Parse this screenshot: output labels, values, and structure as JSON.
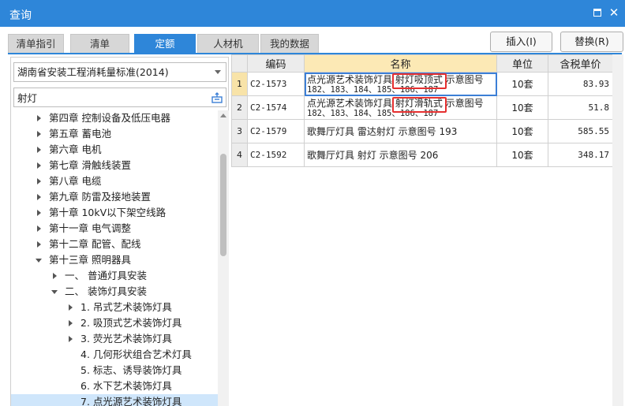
{
  "window": {
    "title": "查询"
  },
  "tabs": [
    {
      "label": "清单指引",
      "active": false
    },
    {
      "label": "清单",
      "active": false
    },
    {
      "label": "定额",
      "active": true
    },
    {
      "label": "人材机",
      "active": false
    },
    {
      "label": "我的数据",
      "active": false
    }
  ],
  "actions": {
    "insert_label": "插入(I)",
    "replace_label": "替换(R)"
  },
  "library": {
    "selected": "湖南省安装工程消耗量标准(2014)"
  },
  "search": {
    "value": "射灯"
  },
  "tree": [
    {
      "label": "第四章 控制设备及低压电器",
      "caret": "right"
    },
    {
      "label": "第五章 蓄电池",
      "caret": "right"
    },
    {
      "label": "第六章 电机",
      "caret": "right"
    },
    {
      "label": "第七章 滑触线装置",
      "caret": "right"
    },
    {
      "label": "第八章 电缆",
      "caret": "right"
    },
    {
      "label": "第九章 防雷及接地装置",
      "caret": "right"
    },
    {
      "label": "第十章 10kV以下架空线路",
      "caret": "right"
    },
    {
      "label": "第十一章 电气调整",
      "caret": "right"
    },
    {
      "label": "第十二章 配管、配线",
      "caret": "right"
    },
    {
      "label": "第十三章 照明器具",
      "caret": "down"
    },
    {
      "label": "一、 普通灯具安装",
      "caret": "right"
    },
    {
      "label": "二、 装饰灯具安装",
      "caret": "down"
    },
    {
      "label": "1. 吊式艺术装饰灯具",
      "caret": "right"
    },
    {
      "label": "2. 吸顶式艺术装饰灯具",
      "caret": "right"
    },
    {
      "label": "3. 荧光艺术装饰灯具",
      "caret": "right"
    },
    {
      "label": "4. 几何形状组合艺术灯具",
      "caret": "none"
    },
    {
      "label": "5. 标志、诱导装饰灯具",
      "caret": "none"
    },
    {
      "label": "6. 水下艺术装饰灯具",
      "caret": "none"
    },
    {
      "label": "7. 点光源艺术装饰灯具",
      "caret": "none",
      "selected": true
    }
  ],
  "grid": {
    "headers": {
      "code": "编码",
      "name": "名称",
      "unit": "单位",
      "price": "含税单价"
    },
    "rows": [
      {
        "num": "1",
        "code": "C2-1573",
        "name_pre": "点光源艺术装饰灯具 ",
        "name_hl": "射灯吸顶式",
        "name_post": " 示意图号",
        "name_sub": "182、183、184、185、186、187",
        "unit": "10套",
        "price": "83.93"
      },
      {
        "num": "2",
        "code": "C2-1574",
        "name_pre": "点光源艺术装饰灯具 ",
        "name_hl": "射灯滑轨式",
        "name_post": " 示意图号",
        "name_sub": "182、183、184、185、186、187",
        "unit": "10套",
        "price": "51.8"
      },
      {
        "num": "3",
        "code": "C2-1579",
        "name": "歌舞厅灯具 雷达射灯 示意图号 193",
        "unit": "10套",
        "price": "585.55"
      },
      {
        "num": "4",
        "code": "C2-1592",
        "name": "歌舞厅灯具 射灯 示意图号 206",
        "unit": "10套",
        "price": "348.17"
      }
    ]
  }
}
